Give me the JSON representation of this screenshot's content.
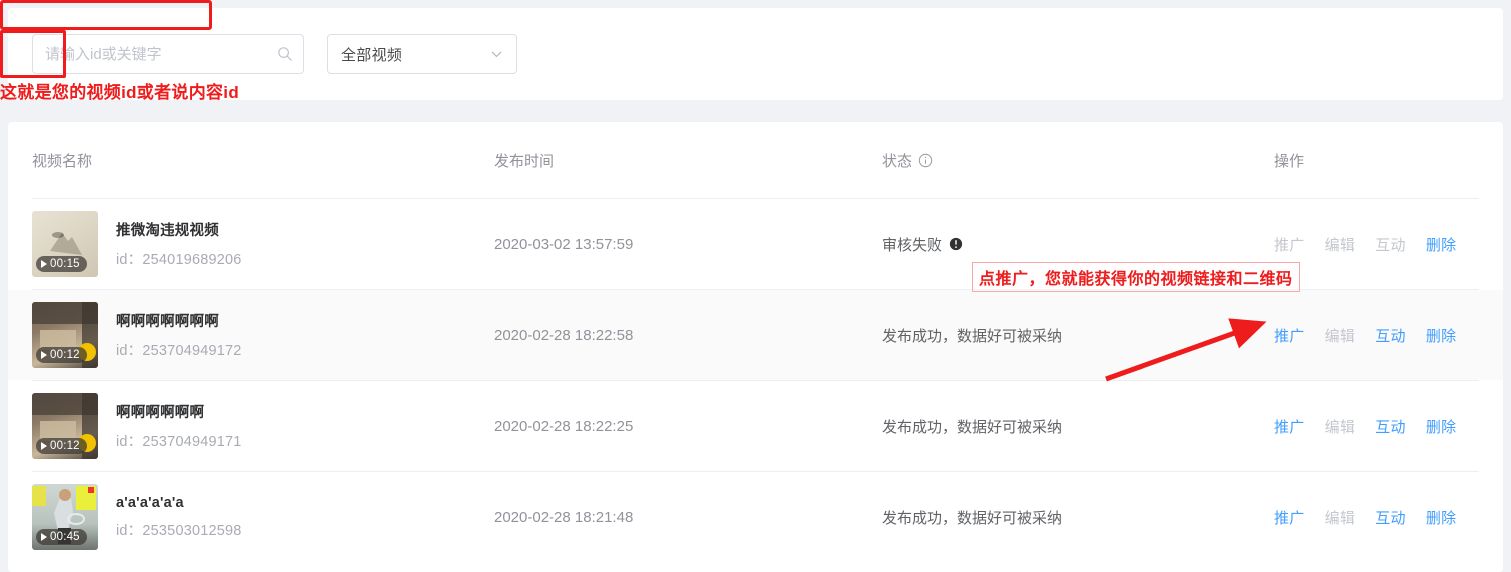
{
  "filter": {
    "search": {
      "value": "",
      "placeholder": "请输入id或关键字",
      "icon": "search-icon"
    },
    "select": {
      "value": "全部视频",
      "icon": "chevron-down-icon"
    }
  },
  "table": {
    "columns": {
      "name": "视频名称",
      "time": "发布时间",
      "state": "状态",
      "state_icon": "info-circle-icon",
      "actions": "操作"
    },
    "rows": [
      {
        "title": "推微淘违规视频",
        "id_label": "id：",
        "id": "254019689206",
        "duration": "00:15",
        "time": "2020-03-02 13:57:59",
        "status": "审核失败",
        "status_icon": "exclamation-circle-icon",
        "actions": [
          {
            "label": "推广",
            "enabled": false
          },
          {
            "label": "编辑",
            "enabled": false
          },
          {
            "label": "互动",
            "enabled": false
          },
          {
            "label": "删除",
            "enabled": true
          }
        ]
      },
      {
        "title": "啊啊啊啊啊啊啊",
        "id_label": "id：",
        "id": "253704949172",
        "duration": "00:12",
        "time": "2020-02-28 18:22:58",
        "status": "发布成功，数据好可被采纳",
        "status_icon": "",
        "actions": [
          {
            "label": "推广",
            "enabled": true
          },
          {
            "label": "编辑",
            "enabled": false
          },
          {
            "label": "互动",
            "enabled": true
          },
          {
            "label": "删除",
            "enabled": true
          }
        ]
      },
      {
        "title": "啊啊啊啊啊啊",
        "id_label": "id：",
        "id": "253704949171",
        "duration": "00:12",
        "time": "2020-02-28 18:22:25",
        "status": "发布成功，数据好可被采纳",
        "status_icon": "",
        "actions": [
          {
            "label": "推广",
            "enabled": true
          },
          {
            "label": "编辑",
            "enabled": false
          },
          {
            "label": "互动",
            "enabled": true
          },
          {
            "label": "删除",
            "enabled": true
          }
        ]
      },
      {
        "title": "a'a'a'a'a'a",
        "id_label": "id：",
        "id": "253503012598",
        "duration": "00:45",
        "time": "2020-02-28 18:21:48",
        "status": "发布成功，数据好可被采纳",
        "status_icon": "",
        "actions": [
          {
            "label": "推广",
            "enabled": true
          },
          {
            "label": "编辑",
            "enabled": false
          },
          {
            "label": "互动",
            "enabled": true
          },
          {
            "label": "删除",
            "enabled": true
          }
        ]
      }
    ]
  },
  "annotations": {
    "top_note": "点推广，您就能获得你的视频链接和二维码",
    "bottom_note": "这就是您的视频id或者说内容id",
    "color": "#ee1c1c"
  }
}
